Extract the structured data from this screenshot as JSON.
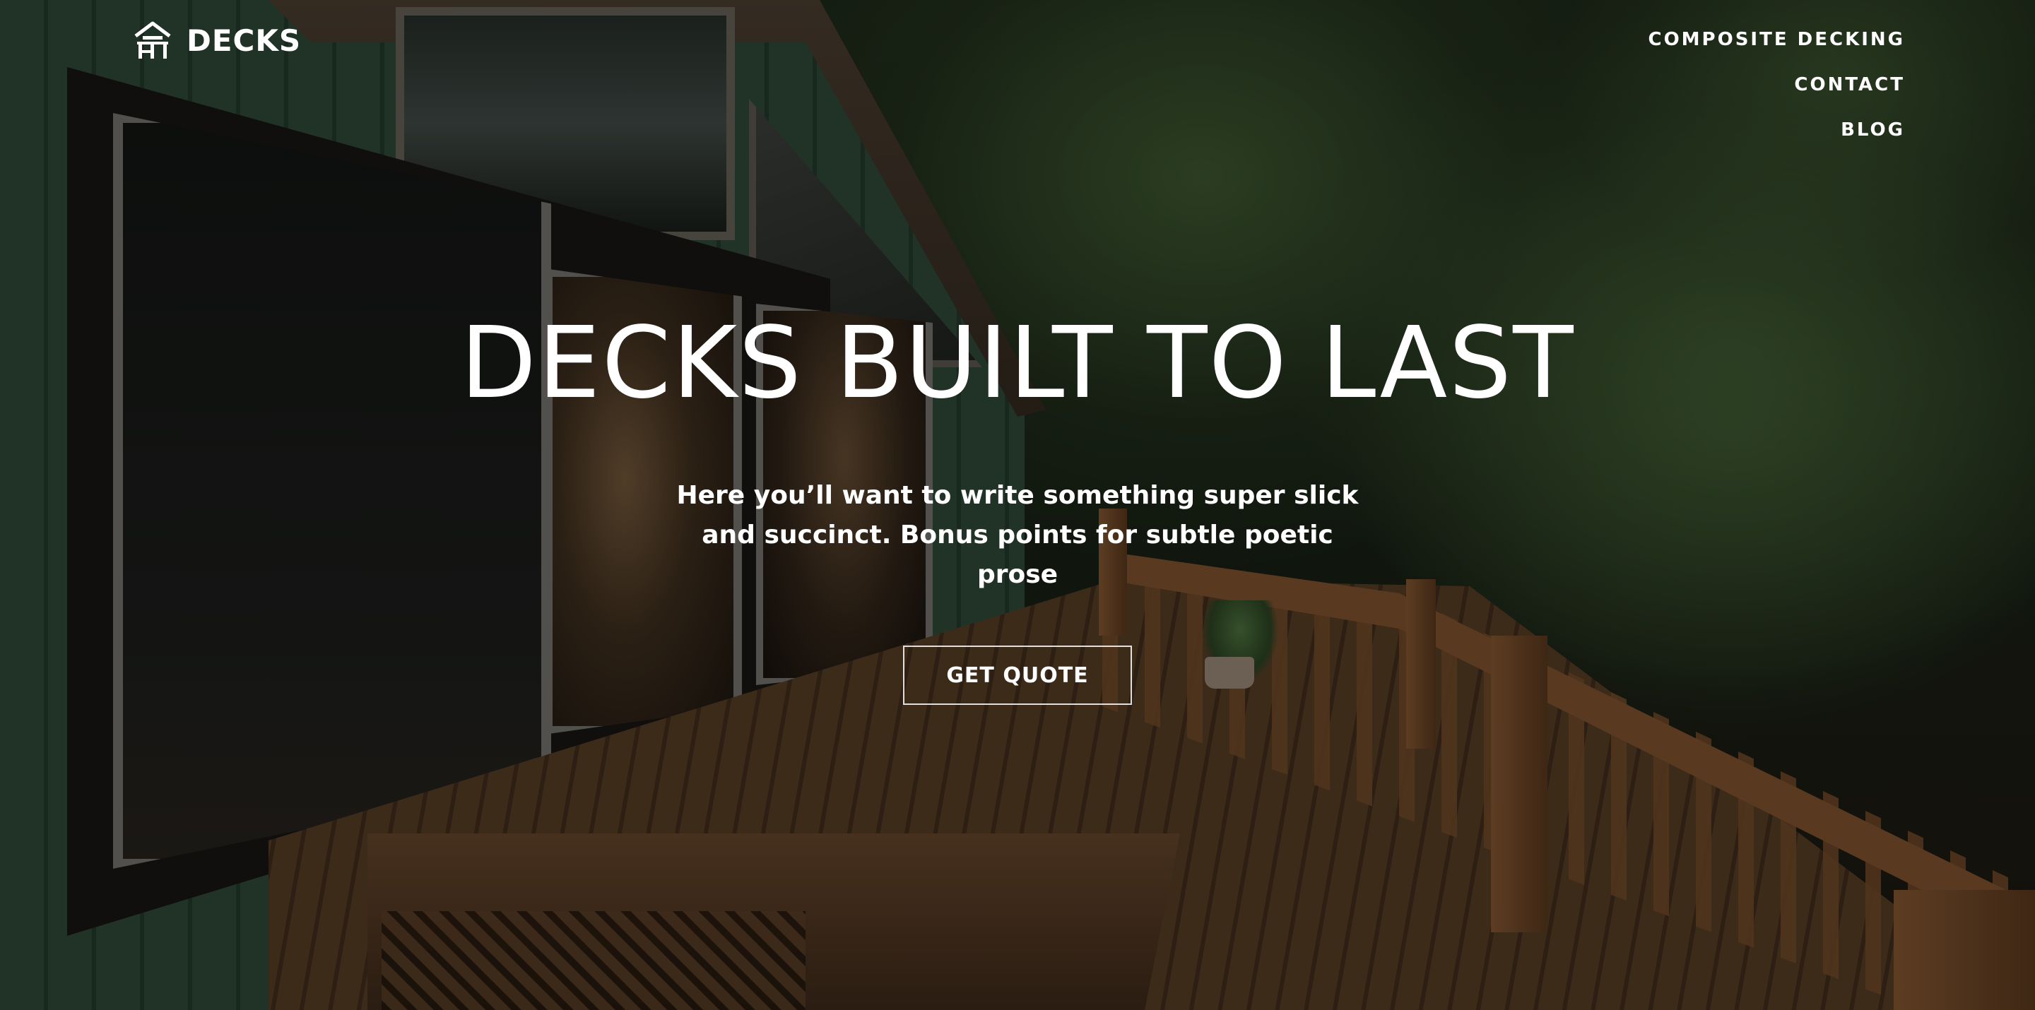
{
  "brand": {
    "name": "DECKS",
    "logo_icon": "deck-house-icon"
  },
  "nav": {
    "items": [
      {
        "label": "COMPOSITE DECKING"
      },
      {
        "label": "CONTACT"
      },
      {
        "label": "BLOG"
      }
    ]
  },
  "hero": {
    "title": "DECKS BUILT TO LAST",
    "subtitle": "Here you’ll want to write something super slick and succinct. Bonus points for subtle poetic prose",
    "cta_label": "GET QUOTE",
    "background_image": "deck-forest-photo",
    "overlay_color": "#000000",
    "text_color": "#ffffff"
  }
}
